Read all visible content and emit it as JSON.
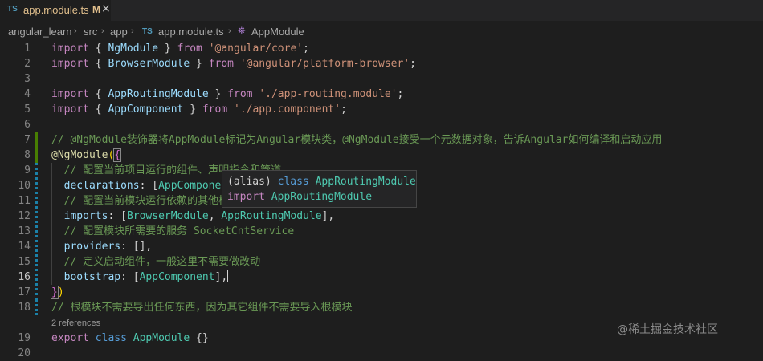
{
  "tab": {
    "lang": "TS",
    "filename": "app.module.ts",
    "modified": "M",
    "close": "×"
  },
  "breadcrumb": {
    "items": [
      "angular_learn",
      "src",
      "app",
      "app.module.ts",
      "AppModule"
    ],
    "file_icon": "TS",
    "separator": "›"
  },
  "editor": {
    "active_line": 16,
    "references": "2 references"
  },
  "hover": {
    "line1_prefix": "(alias) ",
    "line1_kw": "class",
    "line1_name": "AppRoutingModule",
    "line2_kw": "import",
    "line2_name": "AppRoutingModule"
  },
  "watermark": "@稀土掘金技术社区",
  "colors": {
    "background": "#1e1e1e",
    "keyword": "#569cd6",
    "class": "#4ec9b0",
    "string": "#ce9178",
    "comment": "#6a9955",
    "modified": "#e2c08d"
  }
}
